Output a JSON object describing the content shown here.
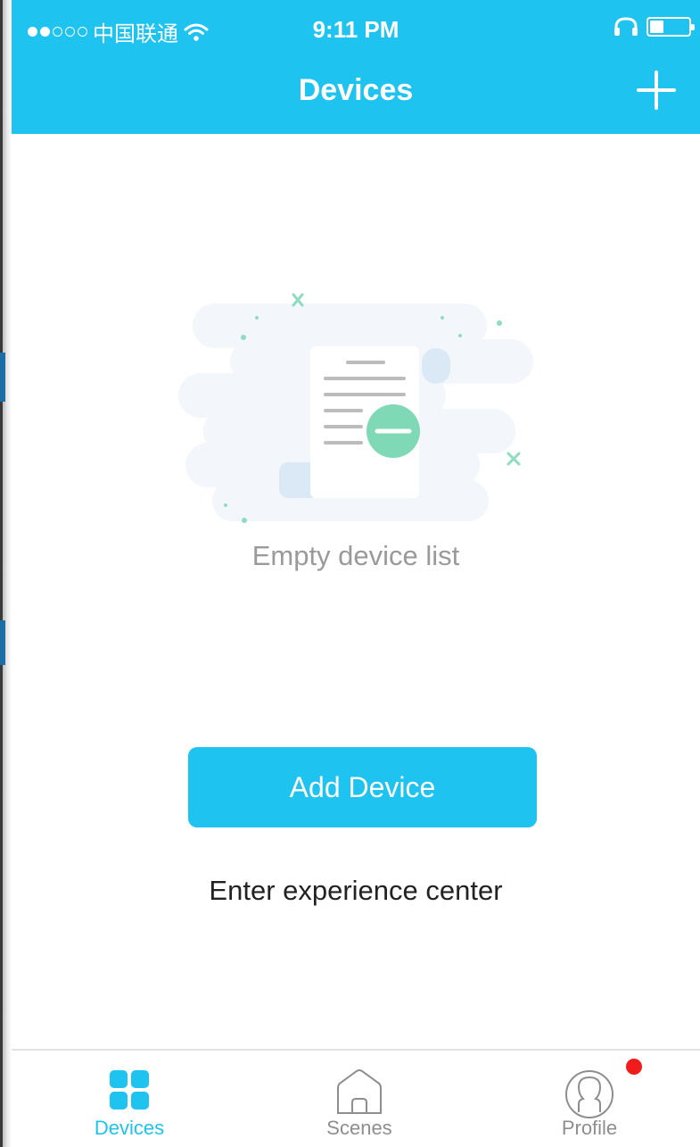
{
  "status_bar": {
    "carrier": "中国联通",
    "time": "9:11 PM",
    "signal_bars_filled": 2,
    "signal_bars_total": 5,
    "battery_level": 0.35
  },
  "header": {
    "title": "Devices",
    "add_icon": "plus-icon"
  },
  "empty_state": {
    "illustration_icon": "empty-document-icon",
    "message": "Empty device list"
  },
  "actions": {
    "add_device_label": "Add Device",
    "experience_center_label": "Enter experience center"
  },
  "tab_bar": {
    "tabs": [
      {
        "label": "Devices",
        "icon": "devices-grid-icon",
        "active": true
      },
      {
        "label": "Scenes",
        "icon": "home-icon",
        "active": false
      },
      {
        "label": "Profile",
        "icon": "profile-icon",
        "active": false,
        "badge": true
      }
    ]
  },
  "colors": {
    "accent": "#1ec3f0",
    "badge": "#f01c1c",
    "illustration_green": "#7fd9b6"
  }
}
